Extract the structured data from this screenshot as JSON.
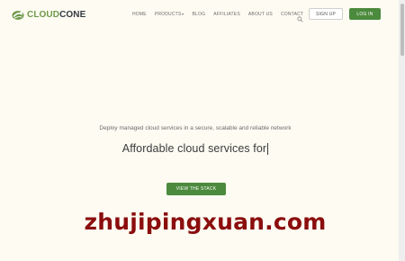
{
  "brand": {
    "logo_part1": "CLOUD",
    "logo_part2": "CONE",
    "logo_icon": "cloudcone-cloud-icon",
    "color_green": "#6f9a4a",
    "color_dark": "#333a40"
  },
  "nav": {
    "items": [
      {
        "label": "HOME"
      },
      {
        "label": "PRODUCTS",
        "has_dropdown": true
      },
      {
        "label": "BLOG"
      },
      {
        "label": "AFFILIATES"
      },
      {
        "label": "ABOUT US"
      },
      {
        "label": "CONTACT"
      }
    ],
    "search_icon": "search-icon",
    "signup_label": "SIGN UP",
    "login_label": "LOG IN"
  },
  "hero": {
    "tagline": "Deploy managed cloud services in a secure, scalable and reliable network",
    "headline": "Affordable cloud services for",
    "cta_label": "VIEW THE STACK",
    "accent_color": "#4c8a3d"
  },
  "watermark": {
    "text": "zhujipingxuan.com",
    "color": "#8b0d0d"
  }
}
